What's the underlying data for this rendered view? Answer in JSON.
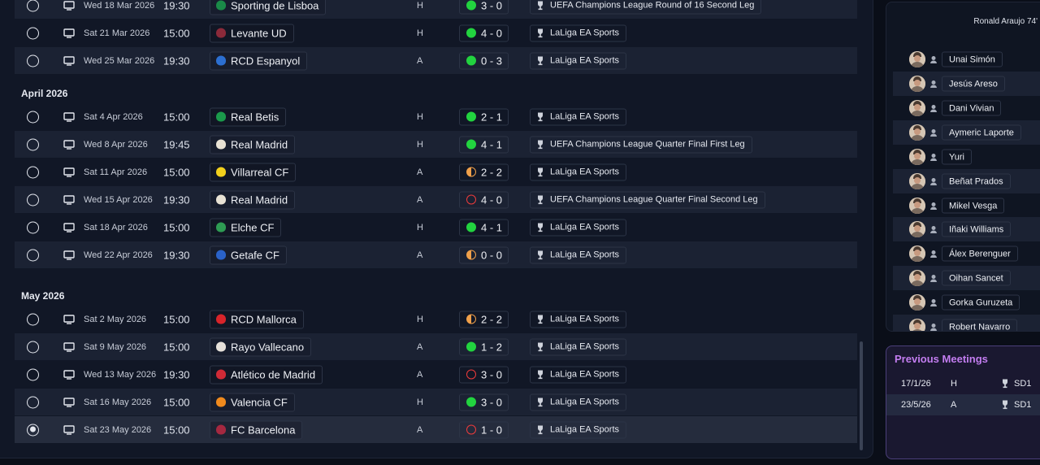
{
  "months": [
    {
      "label": "April 2026"
    },
    {
      "label": "May 2026"
    }
  ],
  "fixtures": [
    {
      "date": "Wed 18 Mar 2026",
      "time": "19:30",
      "team": "Sporting de Lisboa",
      "crest": "#1a8a48",
      "venue": "H",
      "result": "win",
      "score": "3 - 0",
      "competition": "UEFA Champions League Round of 16  Second Leg",
      "selected": false
    },
    {
      "date": "Sat 21 Mar 2026",
      "time": "15:00",
      "team": "Levante UD",
      "crest": "#8b2a3a",
      "venue": "H",
      "result": "win",
      "score": "4 - 0",
      "competition": "LaLiga EA Sports",
      "selected": false
    },
    {
      "date": "Wed 25 Mar 2026",
      "time": "19:30",
      "team": "RCD Espanyol",
      "crest": "#2c6fd1",
      "venue": "A",
      "result": "win",
      "score": "0 - 3",
      "competition": "LaLiga EA Sports",
      "selected": false
    },
    {
      "date": "Sat 4 Apr 2026",
      "time": "15:00",
      "team": "Real Betis",
      "crest": "#1b9a4b",
      "venue": "H",
      "result": "win",
      "score": "2 - 1",
      "competition": "LaLiga EA Sports",
      "selected": false
    },
    {
      "date": "Wed 8 Apr 2026",
      "time": "19:45",
      "team": "Real Madrid",
      "crest": "#e8e2d4",
      "venue": "H",
      "result": "win",
      "score": "4 - 1",
      "competition": "UEFA Champions League Quarter Final First Leg",
      "selected": false
    },
    {
      "date": "Sat 11 Apr 2026",
      "time": "15:00",
      "team": "Villarreal CF",
      "crest": "#f2d01c",
      "venue": "A",
      "result": "draw",
      "score": "2 - 2",
      "competition": "LaLiga EA Sports",
      "selected": false
    },
    {
      "date": "Wed 15 Apr 2026",
      "time": "19:30",
      "team": "Real Madrid",
      "crest": "#e8e2d4",
      "venue": "A",
      "result": "loss",
      "score": "4 - 0",
      "competition": "UEFA Champions League Quarter Final Second Leg",
      "selected": false
    },
    {
      "date": "Sat 18 Apr 2026",
      "time": "15:00",
      "team": "Elche CF",
      "crest": "#2e9b53",
      "venue": "H",
      "result": "win",
      "score": "4 - 1",
      "competition": "LaLiga EA Sports",
      "selected": false
    },
    {
      "date": "Wed 22 Apr 2026",
      "time": "19:30",
      "team": "Getafe CF",
      "crest": "#2a62c9",
      "venue": "A",
      "result": "draw",
      "score": "0 - 0",
      "competition": "LaLiga EA Sports",
      "selected": false
    },
    {
      "date": "Sat 2 May 2026",
      "time": "15:00",
      "team": "RCD Mallorca",
      "crest": "#d8242a",
      "venue": "H",
      "result": "draw",
      "score": "2 - 2",
      "competition": "LaLiga EA Sports",
      "selected": false
    },
    {
      "date": "Sat 9 May 2026",
      "time": "15:00",
      "team": "Rayo Vallecano",
      "crest": "#e6e1da",
      "venue": "A",
      "result": "win",
      "score": "1 - 2",
      "competition": "LaLiga EA Sports",
      "selected": false
    },
    {
      "date": "Wed 13 May 2026",
      "time": "19:30",
      "team": "Atlético de Madrid",
      "crest": "#cf2a36",
      "venue": "A",
      "result": "loss",
      "score": "3 - 0",
      "competition": "LaLiga EA Sports",
      "selected": false
    },
    {
      "date": "Sat 16 May 2026",
      "time": "15:00",
      "team": "Valencia CF",
      "crest": "#f08a1d",
      "venue": "H",
      "result": "win",
      "score": "3 - 0",
      "competition": "LaLiga EA Sports",
      "selected": false
    },
    {
      "date": "Sat 23 May 2026",
      "time": "15:00",
      "team": "FC Barcelona",
      "crest": "#a52840",
      "venue": "A",
      "result": "loss",
      "score": "1 - 0",
      "competition": "LaLiga EA Sports",
      "selected": true
    }
  ],
  "lineup": {
    "scorer": "Ronald Araujo 74'",
    "players": [
      "Unai Simón",
      "Jesús Areso",
      "Dani Vivian",
      "Aymeric Laporte",
      "Yuri",
      "Beñat Prados",
      "Mikel Vesga",
      "Iñaki Williams",
      "Álex Berenguer",
      "Oihan Sancet",
      "Gorka Guruzeta",
      "Robert Navarro"
    ]
  },
  "previous_meetings": {
    "title": "Previous Meetings",
    "rows": [
      {
        "date": "17/1/26",
        "venue": "H",
        "competition": "SD1"
      },
      {
        "date": "23/5/26",
        "venue": "A",
        "competition": "SD1"
      }
    ]
  },
  "colors": {
    "win": "#22d33f",
    "loss": "#ef3b3b",
    "draw": "#f0a04a",
    "accent": "#c37df0"
  }
}
